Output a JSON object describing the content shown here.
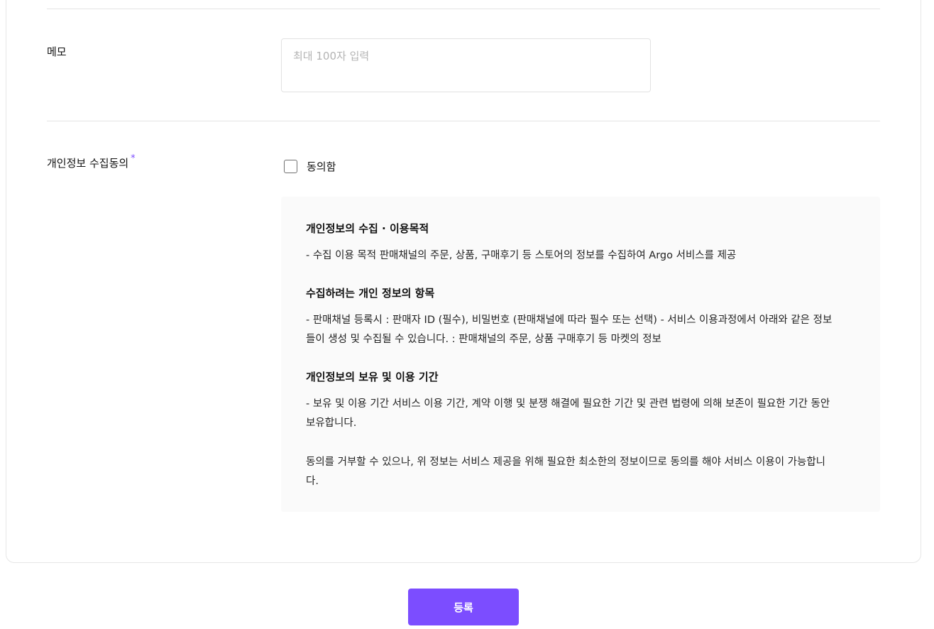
{
  "memo": {
    "label": "메모",
    "placeholder": "최대 100자 입력"
  },
  "consent": {
    "label": "개인정보 수집동의",
    "required_mark": "*",
    "checkbox_label": "동의함",
    "checked": false,
    "sections": [
      {
        "title": "개인정보의 수집 · 이용목적",
        "body": "- 수집 이용 목적 판매채널의 주문, 상품, 구매후기 등 스토어의 정보를 수집하여 Argo 서비스를 제공"
      },
      {
        "title": "수집하려는 개인 정보의 항목",
        "body": "- 판매채널 등록시 : 판매자 ID (필수), 비밀번호 (판매채널에 따라 필수 또는 선택) - 서비스 이용과정에서 아래와 같은 정보들이 생성 및 수집될 수 있습니다. : 판매채널의 주문, 상품 구매후기 등 마켓의 정보"
      },
      {
        "title": "개인정보의 보유 및 이용 기간",
        "body": "- 보유 및 이용 기간 서비스 이용 기간, 계약 이행 및 분쟁 해결에 필요한 기간 및 관련 법령에 의해 보존이 필요한 기간 동안 보유합니다."
      }
    ],
    "note": "동의를 거부할 수 있으나, 위 정보는 서비스 제공을 위해 필요한 최소한의 정보이므로 동의를 해야 서비스 이용이 가능합니다."
  },
  "submit_label": "등록",
  "colors": {
    "accent": "#7c4dff",
    "terms_bg": "#fafafa",
    "divider": "#e4e4e4"
  }
}
